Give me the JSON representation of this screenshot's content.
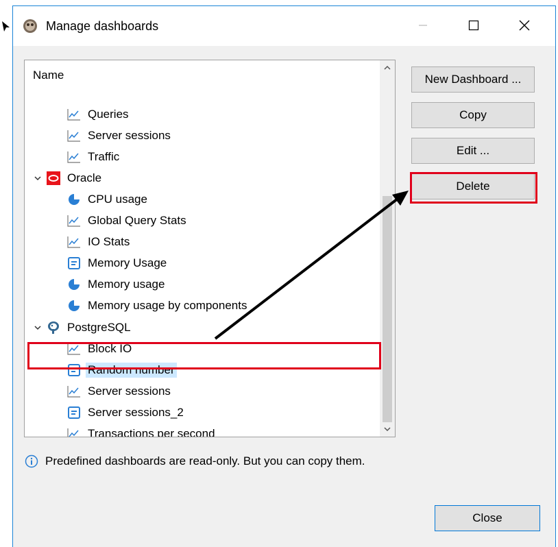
{
  "window": {
    "title": "Manage dashboards",
    "controls": {
      "minimize": "—",
      "maximize": "☐",
      "close": "✕"
    }
  },
  "tree": {
    "header": "Name",
    "rows": [
      {
        "label": "Queries",
        "icon": "line-chart-icon",
        "level": 2
      },
      {
        "label": "Server sessions",
        "icon": "line-chart-icon",
        "level": 2
      },
      {
        "label": "Traffic",
        "icon": "line-chart-icon",
        "level": 2
      },
      {
        "label": "Oracle",
        "icon": "oracle-icon",
        "level": 1,
        "expanded": true
      },
      {
        "label": "CPU usage",
        "icon": "pie-chart-icon",
        "level": 2
      },
      {
        "label": "Global Query Stats",
        "icon": "line-chart-icon",
        "level": 2
      },
      {
        "label": "IO Stats",
        "icon": "line-chart-icon",
        "level": 2
      },
      {
        "label": "Memory Usage",
        "icon": "list-panel-icon",
        "level": 2
      },
      {
        "label": "Memory usage",
        "icon": "pie-chart-icon",
        "level": 2
      },
      {
        "label": "Memory usage by components",
        "icon": "pie-chart-icon",
        "level": 2
      },
      {
        "label": "PostgreSQL",
        "icon": "postgresql-icon",
        "level": 1,
        "expanded": true
      },
      {
        "label": "Block IO",
        "icon": "line-chart-icon",
        "level": 2
      },
      {
        "label": "Random number",
        "icon": "list-panel-icon",
        "level": 2,
        "selected": true
      },
      {
        "label": "Server sessions",
        "icon": "line-chart-icon",
        "level": 2
      },
      {
        "label": "Server sessions_2",
        "icon": "list-panel-icon",
        "level": 2
      },
      {
        "label": "Transactions per second",
        "icon": "line-chart-icon",
        "level": 2
      }
    ]
  },
  "buttons": {
    "new_dashboard": "New Dashboard ...",
    "copy": "Copy",
    "edit": "Edit ...",
    "delete": "Delete",
    "close": "Close"
  },
  "info": {
    "text": "Predefined dashboards are read-only. But you can copy them.",
    "icon": "info-icon"
  },
  "colors": {
    "highlight": "#e0001b",
    "accent_blue": "#1883d7",
    "selection": "#cce8ff"
  }
}
